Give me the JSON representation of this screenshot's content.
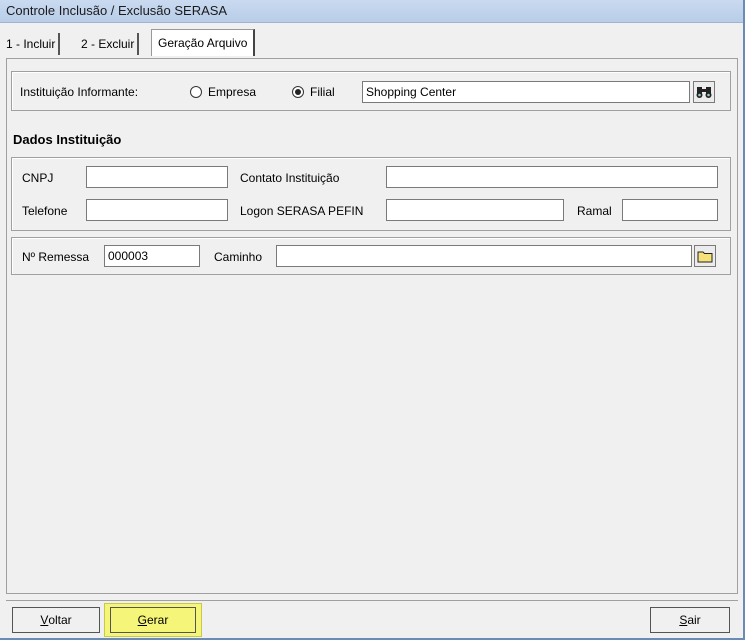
{
  "window": {
    "title": "Controle Inclusão / Exclusão SERASA"
  },
  "tabs": [
    {
      "label": "1 - Incluir"
    },
    {
      "label": "2 - Excluir"
    },
    {
      "label": "Geração Arquivo"
    }
  ],
  "informante": {
    "label": "Instituição Informante:",
    "options": [
      "Empresa",
      "Filial"
    ],
    "selected": "Filial",
    "value": "Shopping Center",
    "search_icon": "binoculars-icon"
  },
  "dados": {
    "title": "Dados Instituição",
    "cnpj_label": "CNPJ",
    "cnpj_value": "",
    "contato_label": "Contato Instituição",
    "contato_value": "",
    "telefone_label": "Telefone",
    "telefone_value": "",
    "logon_label": "Logon SERASA PEFIN",
    "logon_value": "",
    "ramal_label": "Ramal",
    "ramal_value": ""
  },
  "remessa": {
    "label": "Nº Remessa",
    "value": "000003",
    "caminho_label": "Caminho",
    "caminho_value": "",
    "folder_icon": "folder-icon"
  },
  "buttons": {
    "voltar_u": "V",
    "voltar_rest": "oltar",
    "gerar_u": "G",
    "gerar_rest": "erar",
    "sair_u": "S",
    "sair_rest": "air"
  },
  "colors": {
    "highlight": "#f5f57a",
    "titlebar": "#c9daf0"
  }
}
